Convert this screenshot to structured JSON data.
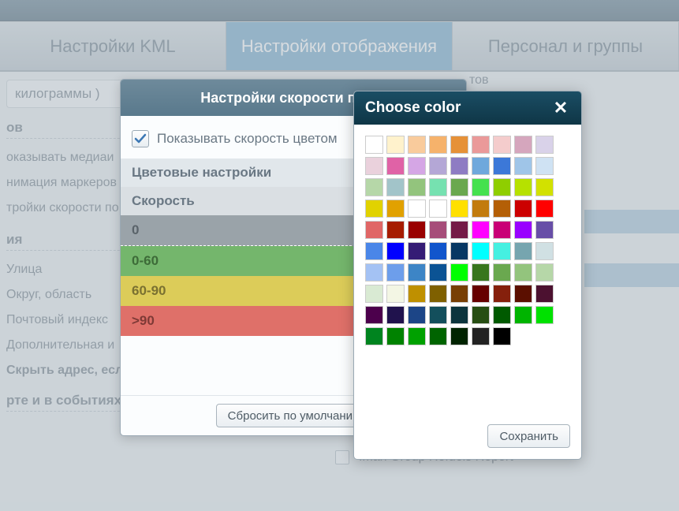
{
  "tabs": {
    "kml": "Настройки KML",
    "display": "Настройки отображения",
    "staff": "Персонал и группы"
  },
  "bg": {
    "kg_input": "килограммы )",
    "suffix1": "тов",
    "section_ov": "ов",
    "opt_media": "оказывать медиаи",
    "opt_anim": "нимация маркеров",
    "opt_speed": "тройки скорости по",
    "section_ya": "ия",
    "opt_street": "Улица",
    "opt_okrug": "Округ, область",
    "opt_post": "Почтовый индекс",
    "opt_addinfo": "Дополнительная и",
    "opt_hide": "Скрыть адрес, если есть геозона",
    "section_map": "рте и в событиях",
    "right_row": "Iman Group Refuels Report"
  },
  "dialog": {
    "title": "Настройки скорости по цв",
    "show_color_label": "Показывать скорость цветом",
    "color_settings": "Цветовые настройки",
    "speed_header": "Скорость",
    "rows": [
      "0",
      "0-60",
      "60-90",
      ">90"
    ],
    "reset_btn": "Сбросить по умолчанин"
  },
  "picker": {
    "title": "Choose color",
    "save_btn": "Сохранить",
    "colors": [
      "#ffffff",
      "#fff2cc",
      "#f9cb9c",
      "#f6b26b",
      "#e69138",
      "#ea9999",
      "#f4cccc",
      "#d5a6bd",
      "#d9d2e9",
      "#ead1dc",
      "#e062a6",
      "#d5a6e5",
      "#b4a7d6",
      "#8e7cc3",
      "#6fa8dc",
      "#3c78d8",
      "#9fc5e8",
      "#cfe2f3",
      "#b6d7a8",
      "#a2c4c9",
      "#93c47d",
      "#76e1b0",
      "#6aa84f",
      "#45e14e",
      "#8fce00",
      "#b6e100",
      "#d2e100",
      "#e1d200",
      "#e1a100",
      "#ffffff",
      "#ffffff",
      "#ffe000",
      "#c27b0e",
      "#b45f06",
      "#cc0000",
      "#ff0000",
      "#e06666",
      "#a61c00",
      "#990000",
      "#a64d79",
      "#741b47",
      "#ff00ff",
      "#c90076",
      "#9900ff",
      "#674ea7",
      "#4a86e8",
      "#0000ff",
      "#351c75",
      "#1155cc",
      "#073763",
      "#00ffff",
      "#45f0e1",
      "#76a5af",
      "#d0e0e3",
      "#a4c2f4",
      "#6d9eeb",
      "#3d85c6",
      "#0b5394",
      "#00ff00",
      "#38761d",
      "#6aa84f",
      "#93c47d",
      "#b6d7a8",
      "#d9ead3",
      "#f3f6e4",
      "#bf9000",
      "#7f6000",
      "#783f04",
      "#660000",
      "#85200c",
      "#5b0f00",
      "#4c1130",
      "#4c004c",
      "#20124d",
      "#1c4587",
      "#134f5c",
      "#0c343d",
      "#274e13",
      "#005a00",
      "#00b400",
      "#00e100",
      "#00841f",
      "#008200",
      "#00a100",
      "#006400",
      "#002300",
      "#222222",
      "#000000"
    ]
  }
}
